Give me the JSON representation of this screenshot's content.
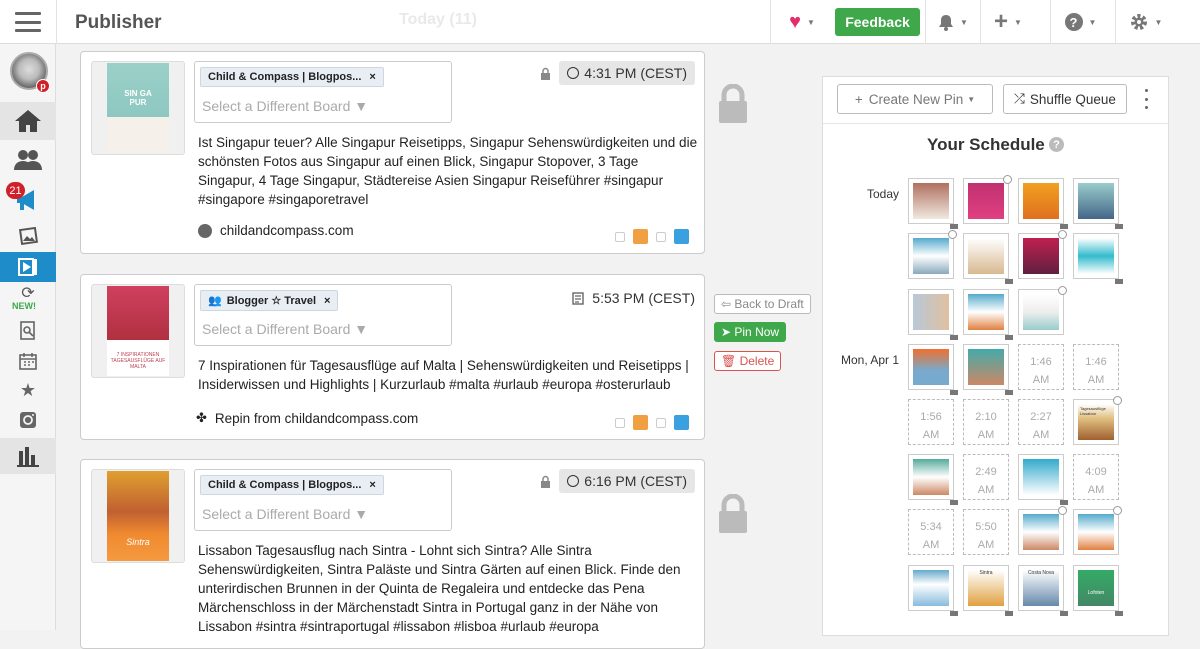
{
  "app": {
    "title": "Publisher",
    "header_center": "Today (11)"
  },
  "topbar": {
    "feedback_label": "Feedback"
  },
  "sidebar": {
    "notification_count": "21",
    "new_label": "NEW!"
  },
  "posts": [
    {
      "board": "Child & Compass | Blogpos...",
      "board_placeholder": "Select a Different Board ▼",
      "time": "4:31 PM (CEST)",
      "description": "Ist Singapur teuer? Alle Singapur Reisetipps, Singapur Sehenswürdigkeiten und die schönsten Fotos aus Singapur auf einen Blick, Singapur Stopover, 3 Tage Singapur, 4 Tage Singapur, Städtereise Asien Singapur Reiseführer #singapur #singapore #singaporetravel",
      "source": "childandcompass.com",
      "thumb_text": "SIN GA PUR"
    },
    {
      "board": "Blogger ☆ Travel",
      "board_placeholder": "Select a Different Board ▼",
      "time": "5:53 PM (CEST)",
      "description": "7 Inspirationen für Tagesausflüge auf Malta | Sehenswürdigkeiten und Reisetipps | Insiderwissen und Highlights | Kurzurlaub #malta #urlaub #europa #osterurlaub",
      "source": "Repin from childandcompass.com",
      "thumb_text": "7 INSPIRATIONEN TAGESAUSFLÜGE AUF MALTA"
    },
    {
      "board": "Child & Compass | Blogpos...",
      "board_placeholder": "Select a Different Board ▼",
      "time": "6:16 PM (CEST)",
      "description": "Lissabon Tagesausflug nach Sintra - Lohnt sich Sintra? Alle Sintra Sehenswürdigkeiten, Sintra Paläste und Sintra Gärten auf einen Blick. Finde den unterirdischen Brunnen in der Quinta de Regaleira und entdecke das Pena Märchenschloss in der Märchenstadt Sintra in Portugal ganz in der Nähe von Lissabon #sintra #sintraportugal #lissabon #lisboa #urlaub #europa",
      "thumb_text": "Sintra"
    }
  ],
  "post_actions": {
    "back_to_draft": "Back to Draft",
    "pin_now": "Pin Now",
    "delete": "Delete"
  },
  "panel": {
    "create_label": "Create New Pin",
    "shuffle_label": "Shuffle Queue",
    "schedule_title": "Your Schedule",
    "help": "?",
    "days": {
      "today": "Today",
      "monday": "Mon, Apr 1"
    },
    "empty_slots": [
      [
        "1:46",
        "AM"
      ],
      [
        "1:46",
        "AM"
      ],
      [
        "1:56",
        "AM"
      ],
      [
        "2:10",
        "AM"
      ],
      [
        "2:27",
        "AM"
      ],
      [
        "2:49",
        "AM"
      ],
      [
        "4:09",
        "AM"
      ],
      [
        "5:34",
        "AM"
      ],
      [
        "5:50",
        "AM"
      ]
    ],
    "tile_texts": [
      "Tagesausflüge Lissabon",
      "Sintra",
      "Costa Nova",
      "Lofoten"
    ]
  },
  "colors": {
    "accent_green": "#3ea84a",
    "badge_red": "#d0202a",
    "nav_active": "#1e8cc8",
    "twitter_blue": "#3aa0e0",
    "pin_orange": "#f0a040"
  }
}
